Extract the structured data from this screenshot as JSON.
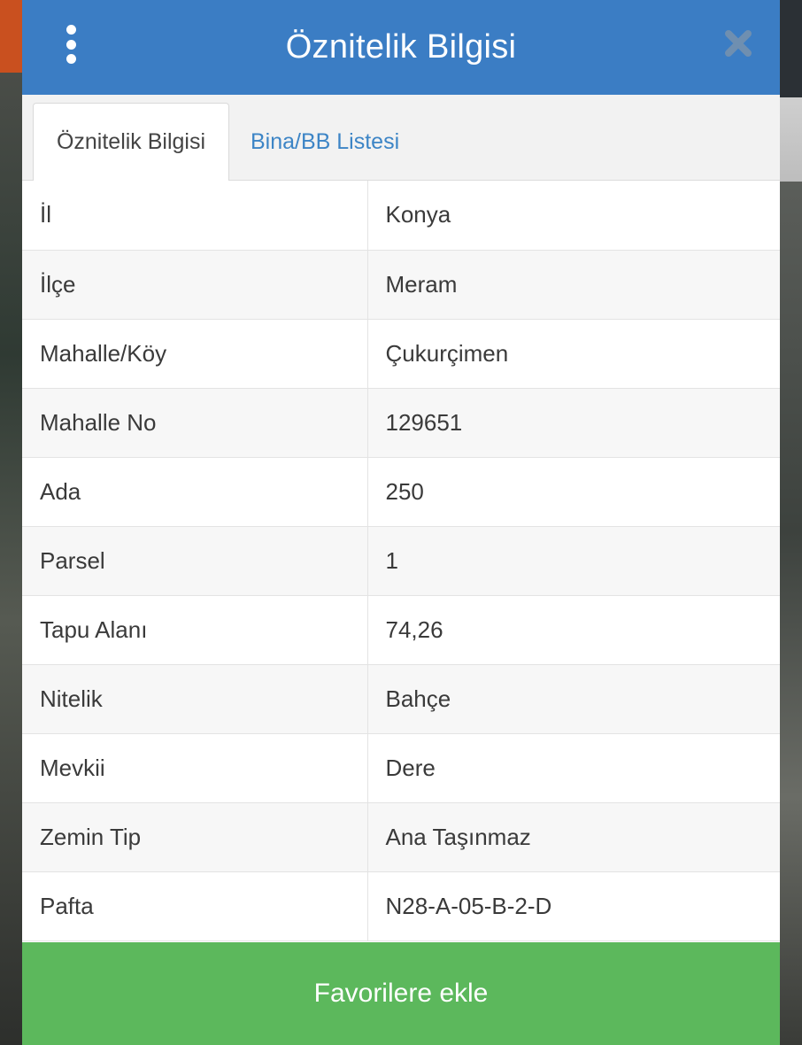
{
  "header": {
    "title": "Öznitelik Bilgisi",
    "menu_icon": "vertical-dots-icon",
    "close_icon": "close-icon"
  },
  "tabs": [
    {
      "label": "Öznitelik Bilgisi",
      "active": true
    },
    {
      "label": "Bina/BB Listesi",
      "active": false
    }
  ],
  "attributes": [
    {
      "key": "İl",
      "value": "Konya"
    },
    {
      "key": "İlçe",
      "value": "Meram"
    },
    {
      "key": "Mahalle/Köy",
      "value": "Çukurçimen"
    },
    {
      "key": "Mahalle No",
      "value": "129651"
    },
    {
      "key": "Ada",
      "value": "250"
    },
    {
      "key": "Parsel",
      "value": "1"
    },
    {
      "key": "Tapu Alanı",
      "value": "74,26"
    },
    {
      "key": "Nitelik",
      "value": "Bahçe"
    },
    {
      "key": "Mevkii",
      "value": "Dere"
    },
    {
      "key": "Zemin Tip",
      "value": "Ana Taşınmaz"
    },
    {
      "key": "Pafta",
      "value": "N28-A-05-B-2-D"
    }
  ],
  "footer": {
    "favorite_label": "Favorilere ekle"
  },
  "colors": {
    "header": "#3b7dc4",
    "tab_link": "#3d85c6",
    "favorite_button": "#5cb85c"
  }
}
